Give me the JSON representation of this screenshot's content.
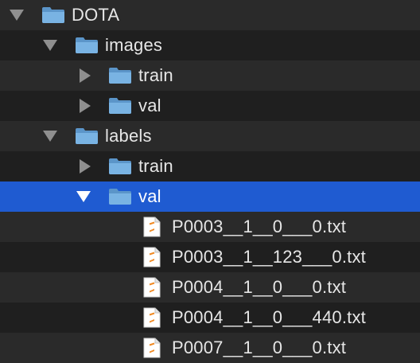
{
  "tree": {
    "root": {
      "label": "DOTA",
      "expanded": true
    },
    "images": {
      "label": "images",
      "expanded": true,
      "children": [
        {
          "label": "train",
          "expanded": false
        },
        {
          "label": "val",
          "expanded": false
        }
      ]
    },
    "labels": {
      "label": "labels",
      "expanded": true,
      "children": [
        {
          "label": "train",
          "expanded": false
        },
        {
          "label": "val",
          "expanded": true,
          "selected": true
        }
      ]
    },
    "files": [
      "P0003__1__0___0.txt",
      "P0003__1__123___0.txt",
      "P0004__1__0___0.txt",
      "P0004__1__0___440.txt",
      "P0007__1__0___0.txt"
    ]
  },
  "colors": {
    "background": "#1e1e1e",
    "row_alt": "#2a2a2a",
    "selection": "#1f5bd1",
    "folder": "#68a3d6",
    "file_accent": "#f08a24"
  }
}
